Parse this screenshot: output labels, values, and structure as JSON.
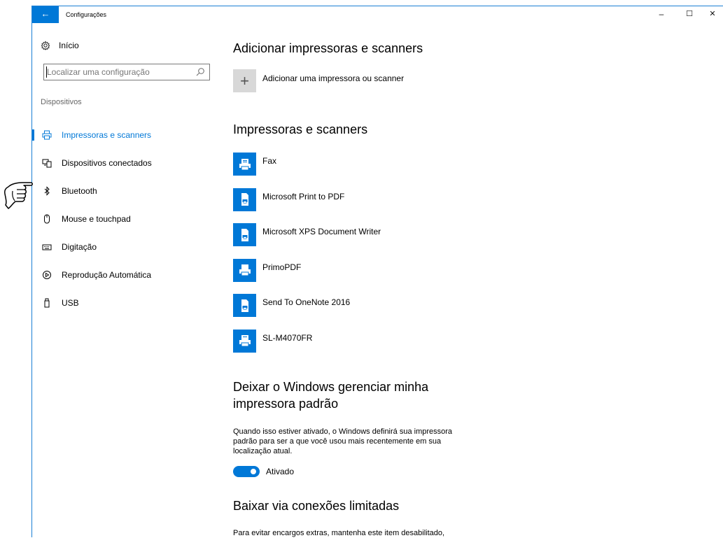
{
  "window": {
    "title": "Configurações",
    "back_icon": "←",
    "minimize_icon": "–",
    "maximize_icon": "☐",
    "close_icon": "✕"
  },
  "sidebar": {
    "home_label": "Início",
    "search_placeholder": "Localizar uma configuração",
    "section_label": "Dispositivos",
    "items": [
      {
        "label": "Impressoras e scanners",
        "icon": "printer-icon",
        "active": true
      },
      {
        "label": "Dispositivos conectados",
        "icon": "connected-devices-icon",
        "active": false
      },
      {
        "label": "Bluetooth",
        "icon": "bluetooth-icon",
        "active": false
      },
      {
        "label": "Mouse e touchpad",
        "icon": "mouse-icon",
        "active": false
      },
      {
        "label": "Digitação",
        "icon": "keyboard-icon",
        "active": false
      },
      {
        "label": "Reprodução Automática",
        "icon": "autoplay-icon",
        "active": false
      },
      {
        "label": "USB",
        "icon": "usb-icon",
        "active": false
      }
    ]
  },
  "main": {
    "add_heading": "Adicionar impressoras e scanners",
    "add_label": "Adicionar uma impressora ou scanner",
    "printers_heading": "Impressoras e scanners",
    "printers": [
      {
        "name": "Fax",
        "icon": "fax-icon"
      },
      {
        "name": "Microsoft Print to PDF",
        "icon": "document-printer-icon"
      },
      {
        "name": "Microsoft XPS Document Writer",
        "icon": "document-printer-icon"
      },
      {
        "name": "PrimoPDF",
        "icon": "printer-icon"
      },
      {
        "name": "Send To OneNote 2016",
        "icon": "document-printer-icon"
      },
      {
        "name": "SL-M4070FR",
        "icon": "printer-icon"
      }
    ],
    "default_heading_line1": "Deixar o Windows gerenciar minha",
    "default_heading_line2": "impressora padrão",
    "default_desc_line1": "Quando isso estiver ativado, o Windows definirá sua impressora",
    "default_desc_line2": "padrão para ser a que você usou mais recentemente em sua",
    "default_desc_line3": "localização atual.",
    "toggle_label": "Ativado",
    "toggle_on": true,
    "metered_heading": "Baixar via conexões limitadas",
    "metered_desc": "Para evitar encargos extras, mantenha este item desabilitado,"
  },
  "colors": {
    "accent": "#0078d7",
    "tile_gray": "#d8d8d8"
  }
}
